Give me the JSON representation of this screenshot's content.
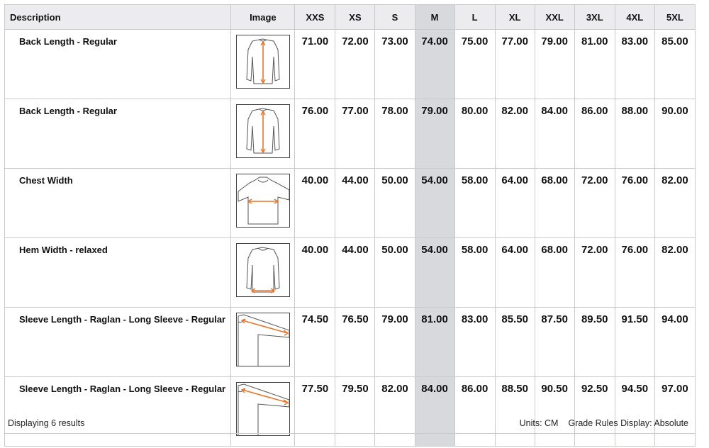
{
  "table": {
    "header": {
      "description": "Description",
      "image": "Image",
      "sizes": [
        "XXS",
        "XS",
        "S",
        "M",
        "L",
        "XL",
        "XXL",
        "3XL",
        "4XL",
        "5XL"
      ]
    },
    "highlight_column": "M",
    "rows": [
      {
        "description": "Back Length - Regular",
        "image_icon": "back-length-diagram-icon",
        "values": [
          "71.00",
          "72.00",
          "73.00",
          "74.00",
          "75.00",
          "77.00",
          "79.00",
          "81.00",
          "83.00",
          "85.00"
        ]
      },
      {
        "description": "Back Length - Regular",
        "image_icon": "back-length-diagram-icon",
        "values": [
          "76.00",
          "77.00",
          "78.00",
          "79.00",
          "80.00",
          "82.00",
          "84.00",
          "86.00",
          "88.00",
          "90.00"
        ]
      },
      {
        "description": "Chest Width",
        "image_icon": "chest-width-diagram-icon",
        "values": [
          "40.00",
          "44.00",
          "50.00",
          "54.00",
          "58.00",
          "64.00",
          "68.00",
          "72.00",
          "76.00",
          "82.00"
        ]
      },
      {
        "description": "Hem Width - relaxed",
        "image_icon": "hem-width-diagram-icon",
        "values": [
          "40.00",
          "44.00",
          "50.00",
          "54.00",
          "58.00",
          "64.00",
          "68.00",
          "72.00",
          "76.00",
          "82.00"
        ]
      },
      {
        "description": "Sleeve Length - Raglan - Long Sleeve - Regular",
        "image_icon": "sleeve-length-diagram-icon",
        "values": [
          "74.50",
          "76.50",
          "79.00",
          "81.00",
          "83.00",
          "85.50",
          "87.50",
          "89.50",
          "91.50",
          "94.00"
        ]
      },
      {
        "description": "Sleeve Length - Raglan - Long Sleeve - Regular",
        "image_icon": "sleeve-length-diagram-icon",
        "values": [
          "77.50",
          "79.50",
          "82.00",
          "84.00",
          "86.00",
          "88.50",
          "90.50",
          "92.50",
          "94.50",
          "97.00"
        ]
      }
    ]
  },
  "footer": {
    "count_text": "Displaying 6 results",
    "units_text": "Units: CM",
    "grade_rules_text": "Grade Rules Display: Absolute"
  },
  "colors": {
    "highlight_column_bg": "#d8d9dd",
    "header_bg": "#ececee",
    "measure_arrow": "#e8762c"
  }
}
